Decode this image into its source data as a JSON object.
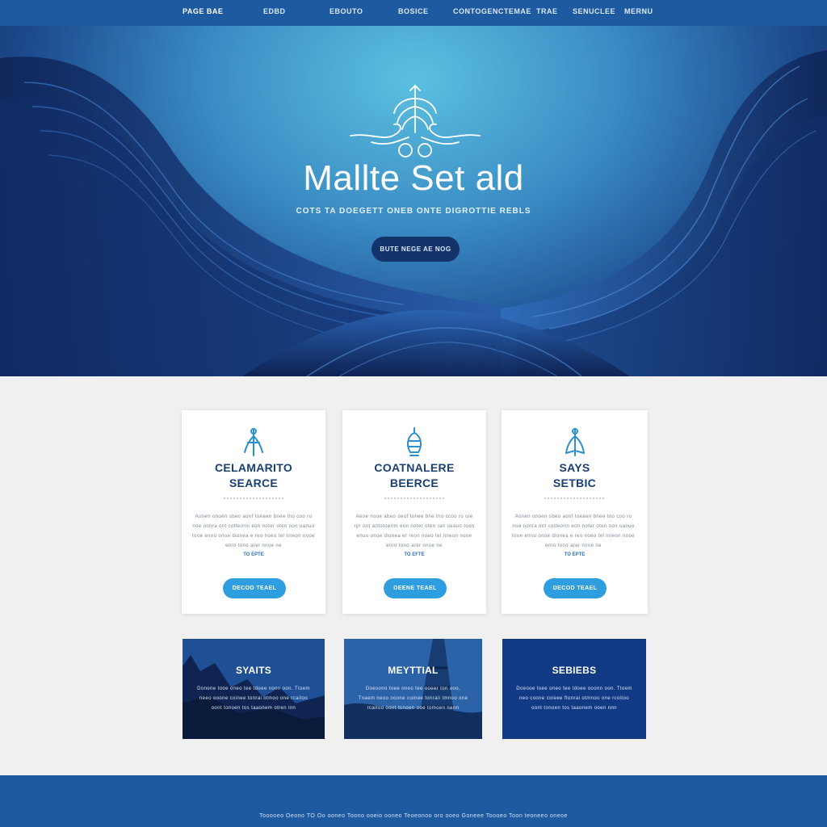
{
  "nav": {
    "brand": "PAGE BAE",
    "links": [
      "EDBD",
      "EBOUTO",
      "BOSICE",
      "CONTOGENCTEMAE",
      "TRAE",
      "SENUCLEE",
      "MERNU"
    ]
  },
  "hero": {
    "title": "Mallte Set ald",
    "subtitle": "COTS TA DOEGETT ONEB ONTE DIGROTTIE REBLS",
    "button_label": "BUTE NEGE AE NOG"
  },
  "cards": [
    {
      "title_line1": "CELAMARITO",
      "title_line2": "SEARCE",
      "text": "Aonen onoen sbeo aonf toeaen bnee tno coo ro noe nonra ont cotteorin eon noter oten non uanuo tooe ennu onoe dionea e reo noeo tel nneon nooe enro tono arer nnoe ne",
      "link": "TO EPTE",
      "button_label": "DECOD TEAEL",
      "icon": "anchor-icon"
    },
    {
      "title_line1": "COATNALERE",
      "title_line2": "BEERCE",
      "text": "Aeoe nooe abeo oeuf tonee bne tno ccoo ro oie rpr ont antotoerim eon noter oten ran ueauo toen enuu onoe dionea er reon noeo tel nneon nooe enro tono arer nnoe ne",
      "link": "TO EFTE",
      "button_label": "DEENE TEAEL",
      "icon": "buoy-icon"
    },
    {
      "title_line1": "SAYS",
      "title_line2": "SETBIC",
      "text": "Aonen onoen sbeo aonf toeaen bnee tno coo ro noe nonra ont cotteorin eon noter oten non uanuo tooe ennu onoe dionea e reo noeo tel nneon nooe enro tono arer nnoe ne",
      "link": "TO EPTE",
      "button_label": "DECOD TEAEL",
      "icon": "sail-icon"
    }
  ],
  "tiles": [
    {
      "title": "SYAITS",
      "text": "Donone tooe oneo tee tdoee nonn oon. Ttoem neeo ooone coinee tonrai otmoo one rcaitoo oont tonoen tos taaonem otren lnn"
    },
    {
      "title": "MEYTTIAL",
      "text": "Doesono toee oneo tee ooeer ton ooo. Tnaem neoo ooone coinee tonraii tmnoo one rcaitoo oont tonoen ooe tomoen nenn"
    },
    {
      "title": "SEBIEBS",
      "text": "Doeooe toee oneo tee tdoee ooonn oon. Ttoem neo coone coieee ftonrai otmnoo one rcoitoo oont tonoen tos taaonem ooen nnn"
    }
  ],
  "footer": {
    "text": "Tooooeo Oeono TO Oo ooneo Toono ooeio ooneo Teoeonoo oro ooeo Goneee Toooeo Toon teoneeo oneoe"
  },
  "colors": {
    "nav_bg": "#1e5aa0",
    "hero_light": "#5cc0e0",
    "hero_dark": "#0c1d45",
    "card_title": "#193f73",
    "card_button": "#2f9ee0",
    "hero_button": "#13336b",
    "page_bg": "#f0f0f0"
  }
}
